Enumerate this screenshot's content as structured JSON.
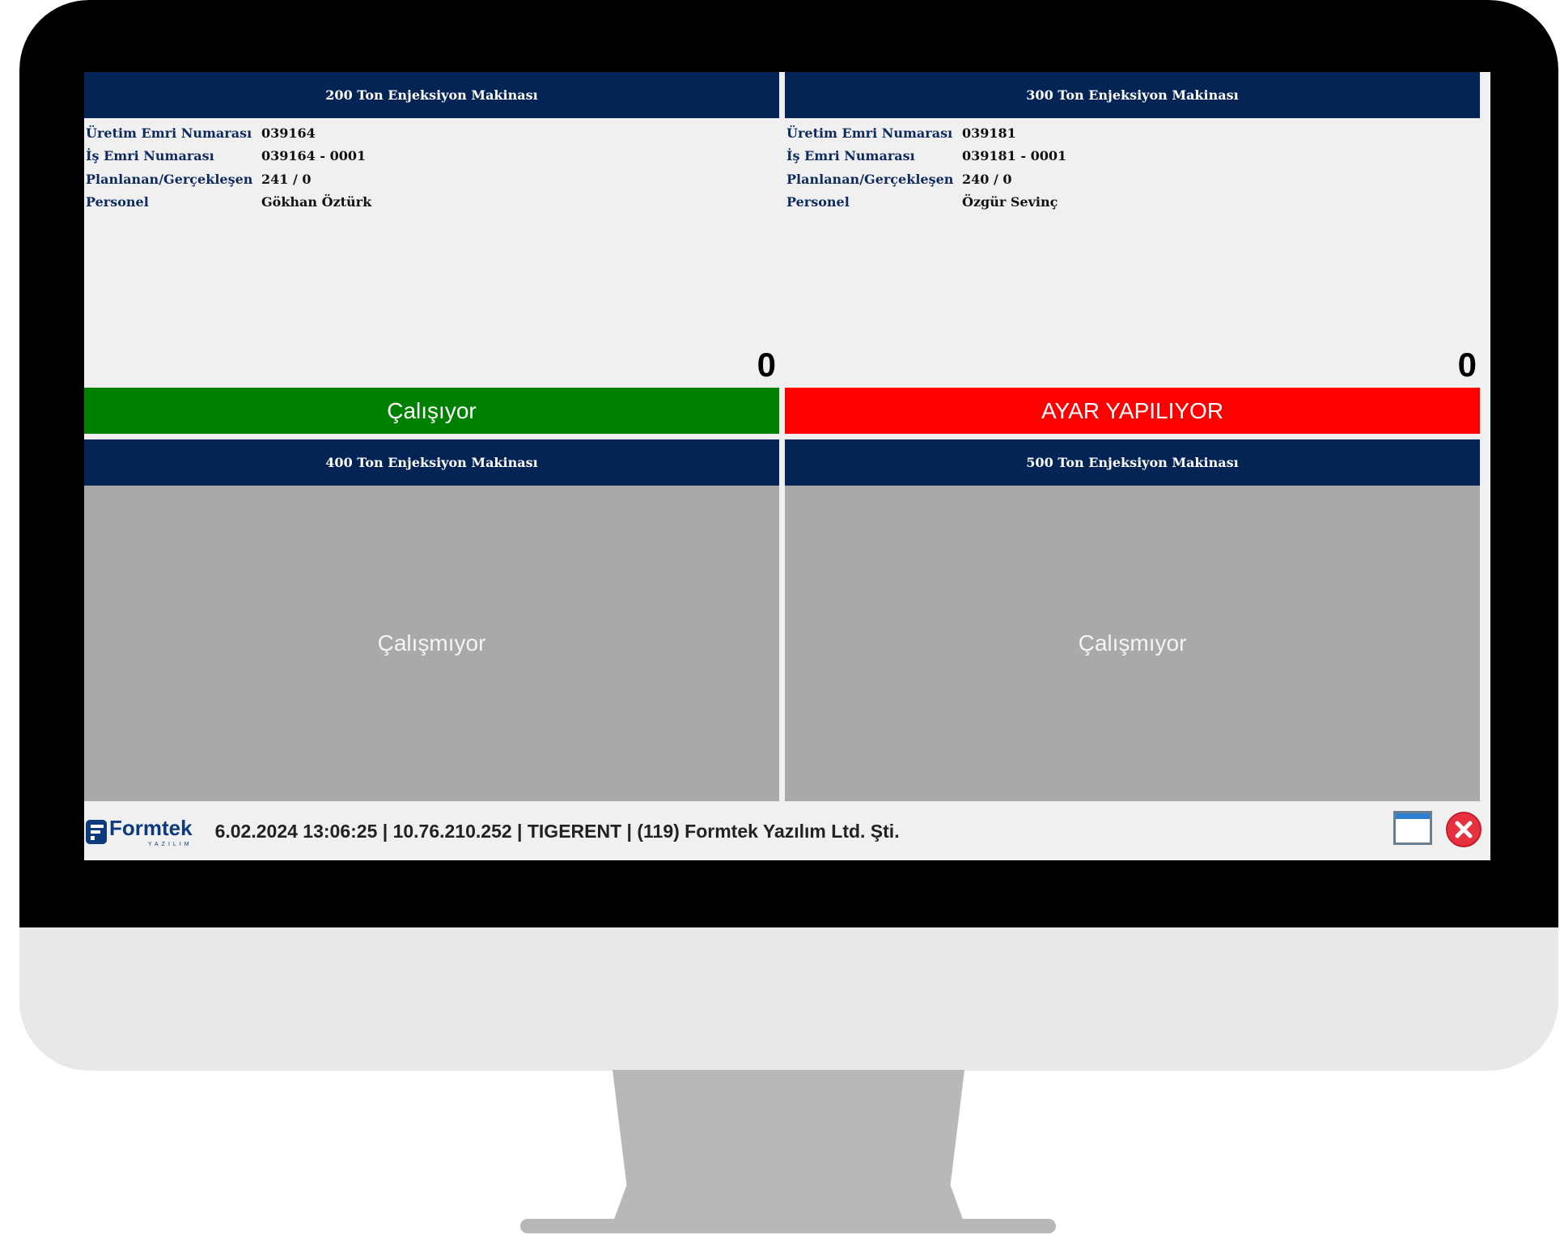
{
  "labels": {
    "uretim": "Üretim Emri Numarası",
    "isemri": "İş Emri Numarası",
    "planlanan": "Planlanan/Gerçekleşen",
    "personel": "Personel"
  },
  "machines": [
    {
      "title": "200 Ton Enjeksiyon Makinası",
      "uretim_emri": "039164",
      "is_emri": "039164 - 0001",
      "planlanan": "241 / 0",
      "personel": "Gökhan Öztürk",
      "count": "0",
      "status": "Çalışıyor",
      "status_color": "#008000"
    },
    {
      "title": "300 Ton Enjeksiyon Makinası",
      "uretim_emri": "039181",
      "is_emri": "039181 - 0001",
      "planlanan": "240 / 0",
      "personel": "Özgür Sevinç",
      "count": "0",
      "status": "AYAR YAPILIYOR",
      "status_color": "#ff0000"
    },
    {
      "title": "400 Ton Enjeksiyon Makinası",
      "status": "Çalışmıyor",
      "status_color": "#a9a9a9"
    },
    {
      "title": "500 Ton Enjeksiyon Makinası",
      "status": "Çalışmıyor",
      "status_color": "#a9a9a9"
    }
  ],
  "footer": {
    "brand": "Formtek",
    "brand_sub": "YAZILIM",
    "info": "6.02.2024 13:06:25 | 10.76.210.252 | TIGERENT | (119) Formtek Yazılım Ltd. Şti."
  },
  "colors": {
    "header_bg": "#052456",
    "brand": "#0d3a7a",
    "close": "#e8313f"
  },
  "icons": {
    "window": "window-icon",
    "close": "close-circle-icon",
    "logo": "formtek-logo-icon"
  }
}
